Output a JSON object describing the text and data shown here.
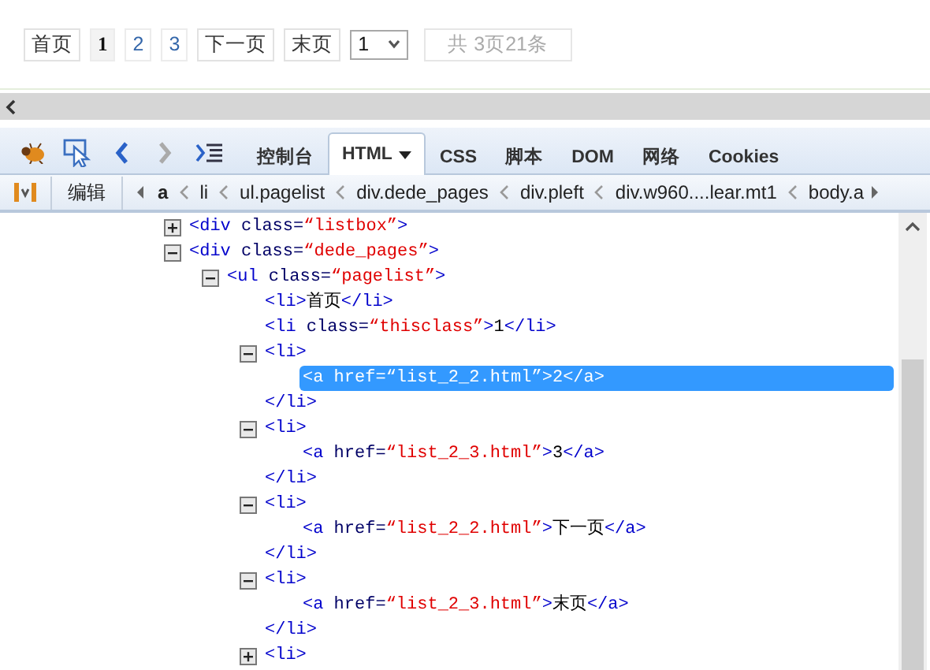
{
  "pager": {
    "items": [
      {
        "label": "首页",
        "kind": "nav",
        "selected": false
      },
      {
        "label": "1",
        "kind": "page",
        "selected": true
      },
      {
        "label": "2",
        "kind": "page",
        "selected": false
      },
      {
        "label": "3",
        "kind": "page",
        "selected": false
      },
      {
        "label": "下一页",
        "kind": "nav",
        "selected": false
      },
      {
        "label": "末页",
        "kind": "nav",
        "selected": false
      }
    ],
    "select": {
      "value": "1"
    },
    "info": "共 3页21条"
  },
  "devtools": {
    "tabs": [
      {
        "label": "控制台",
        "selected": false
      },
      {
        "label": "HTML",
        "selected": true
      },
      {
        "label": "CSS",
        "selected": false
      },
      {
        "label": "脚本",
        "selected": false
      },
      {
        "label": "DOM",
        "selected": false
      },
      {
        "label": "网络",
        "selected": false
      },
      {
        "label": "Cookies",
        "selected": false
      }
    ],
    "breadcrumb": {
      "button": "编辑",
      "items": [
        {
          "label": "a",
          "selected": true
        },
        {
          "label": "li",
          "selected": false
        },
        {
          "label": "ul.pagelist",
          "selected": false
        },
        {
          "label": "div.dede_pages",
          "selected": false
        },
        {
          "label": "div.pleft",
          "selected": false
        },
        {
          "label": "div.w960....lear.mt1",
          "selected": false
        },
        {
          "label": "body.a",
          "selected": false
        }
      ]
    },
    "tree": [
      {
        "selected": false,
        "expanded": false,
        "open": [
          {
            "kind": "tag",
            "text": "<div"
          },
          {
            "kind": "attr",
            "text": " class="
          },
          {
            "kind": "value",
            "text": "“listbox”"
          },
          {
            "kind": "tag",
            "text": ">"
          }
        ]
      },
      {
        "selected": false,
        "expanded": true,
        "open": [
          {
            "kind": "tag",
            "text": "<div"
          },
          {
            "kind": "attr",
            "text": " class="
          },
          {
            "kind": "value",
            "text": "“dede_pages”"
          },
          {
            "kind": "tag",
            "text": ">"
          }
        ],
        "children": [
          {
            "selected": false,
            "expanded": true,
            "open": [
              {
                "kind": "tag",
                "text": "<ul"
              },
              {
                "kind": "attr",
                "text": " class="
              },
              {
                "kind": "value",
                "text": "“pagelist”"
              },
              {
                "kind": "tag",
                "text": ">"
              }
            ],
            "children": [
              {
                "selected": false,
                "open": [
                  {
                    "kind": "tag",
                    "text": "<li>"
                  },
                  {
                    "kind": "text",
                    "text": "首页"
                  },
                  {
                    "kind": "tag",
                    "text": "</li>"
                  }
                ]
              },
              {
                "selected": false,
                "open": [
                  {
                    "kind": "tag",
                    "text": "<li"
                  },
                  {
                    "kind": "attr",
                    "text": " class="
                  },
                  {
                    "kind": "value",
                    "text": "“thisclass”"
                  },
                  {
                    "kind": "tag",
                    "text": ">"
                  },
                  {
                    "kind": "text",
                    "text": "1"
                  },
                  {
                    "kind": "tag",
                    "text": "</li>"
                  }
                ]
              },
              {
                "selected": false,
                "expanded": true,
                "open": [
                  {
                    "kind": "tag",
                    "text": "<li>"
                  }
                ],
                "close": [
                  {
                    "kind": "tag",
                    "text": "</li>"
                  }
                ],
                "children": [
                  {
                    "selected": true,
                    "open": [
                      {
                        "kind": "tag",
                        "text": "<a"
                      },
                      {
                        "kind": "attr",
                        "text": " href="
                      },
                      {
                        "kind": "value",
                        "text": "“list_2_2.html”"
                      },
                      {
                        "kind": "tag",
                        "text": ">"
                      },
                      {
                        "kind": "text",
                        "text": "2"
                      },
                      {
                        "kind": "tag",
                        "text": "</a>"
                      }
                    ]
                  }
                ]
              },
              {
                "selected": false,
                "expanded": true,
                "open": [
                  {
                    "kind": "tag",
                    "text": "<li>"
                  }
                ],
                "close": [
                  {
                    "kind": "tag",
                    "text": "</li>"
                  }
                ],
                "children": [
                  {
                    "selected": false,
                    "open": [
                      {
                        "kind": "tag",
                        "text": "<a"
                      },
                      {
                        "kind": "attr",
                        "text": " href="
                      },
                      {
                        "kind": "value",
                        "text": "“list_2_3.html”"
                      },
                      {
                        "kind": "tag",
                        "text": ">"
                      },
                      {
                        "kind": "text",
                        "text": "3"
                      },
                      {
                        "kind": "tag",
                        "text": "</a>"
                      }
                    ]
                  }
                ]
              },
              {
                "selected": false,
                "expanded": true,
                "open": [
                  {
                    "kind": "tag",
                    "text": "<li>"
                  }
                ],
                "close": [
                  {
                    "kind": "tag",
                    "text": "</li>"
                  }
                ],
                "children": [
                  {
                    "selected": false,
                    "open": [
                      {
                        "kind": "tag",
                        "text": "<a"
                      },
                      {
                        "kind": "attr",
                        "text": " href="
                      },
                      {
                        "kind": "value",
                        "text": "“list_2_2.html”"
                      },
                      {
                        "kind": "tag",
                        "text": ">"
                      },
                      {
                        "kind": "text",
                        "text": "下一页"
                      },
                      {
                        "kind": "tag",
                        "text": "</a>"
                      }
                    ]
                  }
                ]
              },
              {
                "selected": false,
                "expanded": true,
                "open": [
                  {
                    "kind": "tag",
                    "text": "<li>"
                  }
                ],
                "close": [
                  {
                    "kind": "tag",
                    "text": "</li>"
                  }
                ],
                "children": [
                  {
                    "selected": false,
                    "open": [
                      {
                        "kind": "tag",
                        "text": "<a"
                      },
                      {
                        "kind": "attr",
                        "text": " href="
                      },
                      {
                        "kind": "value",
                        "text": "“list_2_3.html”"
                      },
                      {
                        "kind": "tag",
                        "text": ">"
                      },
                      {
                        "kind": "text",
                        "text": "末页"
                      },
                      {
                        "kind": "tag",
                        "text": "</a>"
                      }
                    ]
                  }
                ]
              },
              {
                "selected": false,
                "expanded": false,
                "open": [
                  {
                    "kind": "tag",
                    "text": "<li>"
                  }
                ]
              }
            ]
          }
        ]
      }
    ]
  }
}
